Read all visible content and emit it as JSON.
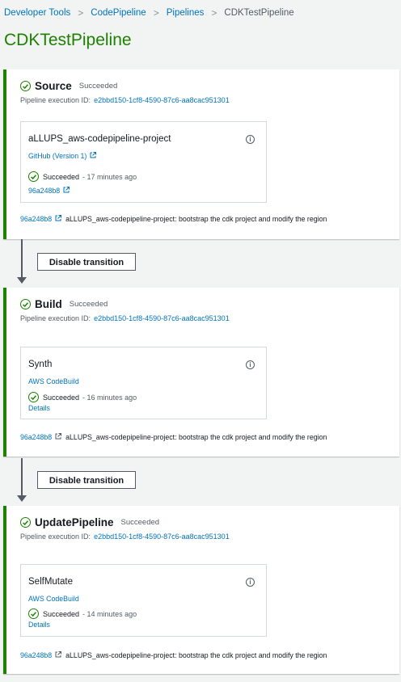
{
  "breadcrumb": {
    "items": [
      "Developer Tools",
      "CodePipeline",
      "Pipelines",
      "CDKTestPipeline"
    ],
    "separator": ">"
  },
  "page_title": "CDKTestPipeline",
  "colors": {
    "succeeded_green": "#1d8102",
    "link_blue": "#0073bb",
    "background": "#f2f3f3"
  },
  "exec_label": "Pipeline execution ID:",
  "transition_label": "Disable transition",
  "stages": [
    {
      "name": "Source",
      "status": "Succeeded",
      "execution_id": "e2bbd150-1cf8-4590-87c6-aa8cac951301",
      "action": {
        "name": "aLLUPS_aws-codepipeline-project",
        "provider": "GitHub (Version 1)",
        "provider_external": true,
        "status": "Succeeded",
        "time": "17 minutes ago",
        "link": "96a248b8",
        "link_external": true
      },
      "commit": {
        "id": "96a248b8",
        "message": "aLLUPS_aws-codepipeline-project: bootstrap the cdk project and modify the region"
      }
    },
    {
      "name": "Build",
      "status": "Succeeded",
      "execution_id": "e2bbd150-1cf8-4590-87c6-aa8cac951301",
      "action": {
        "name": "Synth",
        "provider": "AWS CodeBuild",
        "status": "Succeeded",
        "time": "16 minutes ago",
        "link": "Details"
      },
      "commit": {
        "id": "96a248b8",
        "message": "aLLUPS_aws-codepipeline-project: bootstrap the cdk project and modify the region"
      }
    },
    {
      "name": "UpdatePipeline",
      "status": "Succeeded",
      "execution_id": "e2bbd150-1cf8-4590-87c6-aa8cac951301",
      "action": {
        "name": "SelfMutate",
        "provider": "AWS CodeBuild",
        "status": "Succeeded",
        "time": "14 minutes ago",
        "link": "Details"
      },
      "commit": {
        "id": "96a248b8",
        "message": "aLLUPS_aws-codepipeline-project: bootstrap the cdk project and modify the region"
      }
    }
  ]
}
